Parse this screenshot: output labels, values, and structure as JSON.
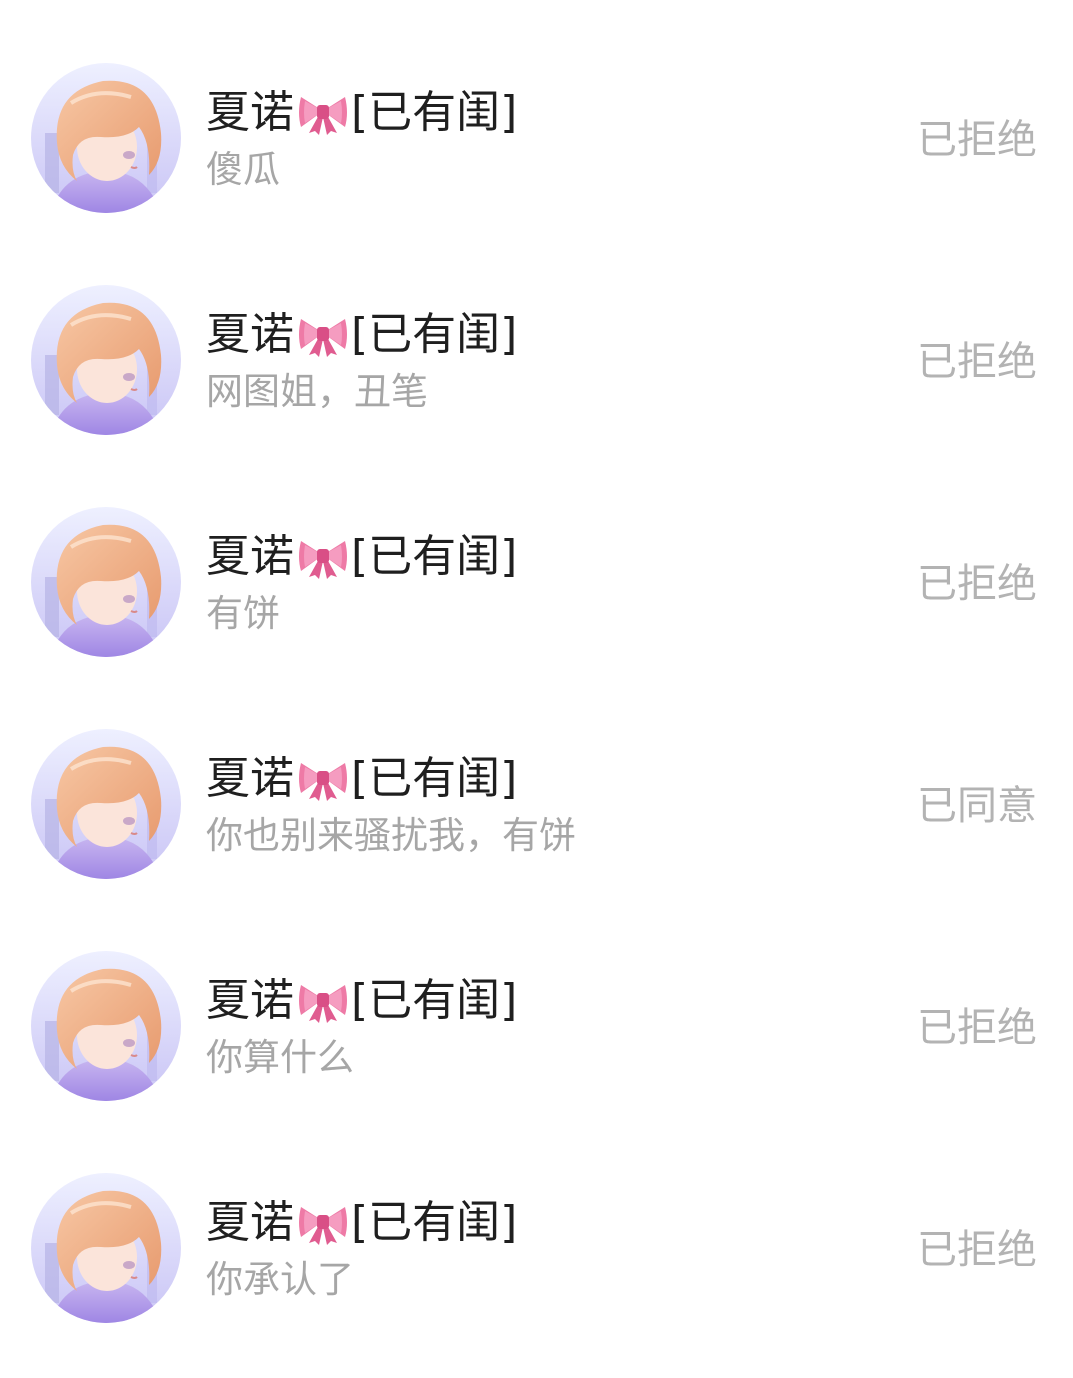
{
  "requests": [
    {
      "name": "夏诺",
      "tag": "[已有闺]",
      "message": "傻瓜",
      "status": "已拒绝"
    },
    {
      "name": "夏诺",
      "tag": "[已有闺]",
      "message": "网图姐，丑笔",
      "status": "已拒绝"
    },
    {
      "name": "夏诺",
      "tag": "[已有闺]",
      "message": "有饼",
      "status": "已拒绝"
    },
    {
      "name": "夏诺",
      "tag": "[已有闺]",
      "message": "你也别来骚扰我，有饼",
      "status": "已同意"
    },
    {
      "name": "夏诺",
      "tag": "[已有闺]",
      "message": "你算什么",
      "status": "已拒绝"
    },
    {
      "name": "夏诺",
      "tag": "[已有闺]",
      "message": "你承认了",
      "status": "已拒绝"
    }
  ],
  "icons": {
    "avatar": "anime-girl-avatar",
    "bow": "pink-ribbon-bow-emoji"
  },
  "colors": {
    "background": "#ffffff",
    "name_text": "#1f1f1f",
    "message_text": "#a6a6a6",
    "status_text": "#b3b3b3",
    "bow": "#e8679a"
  }
}
